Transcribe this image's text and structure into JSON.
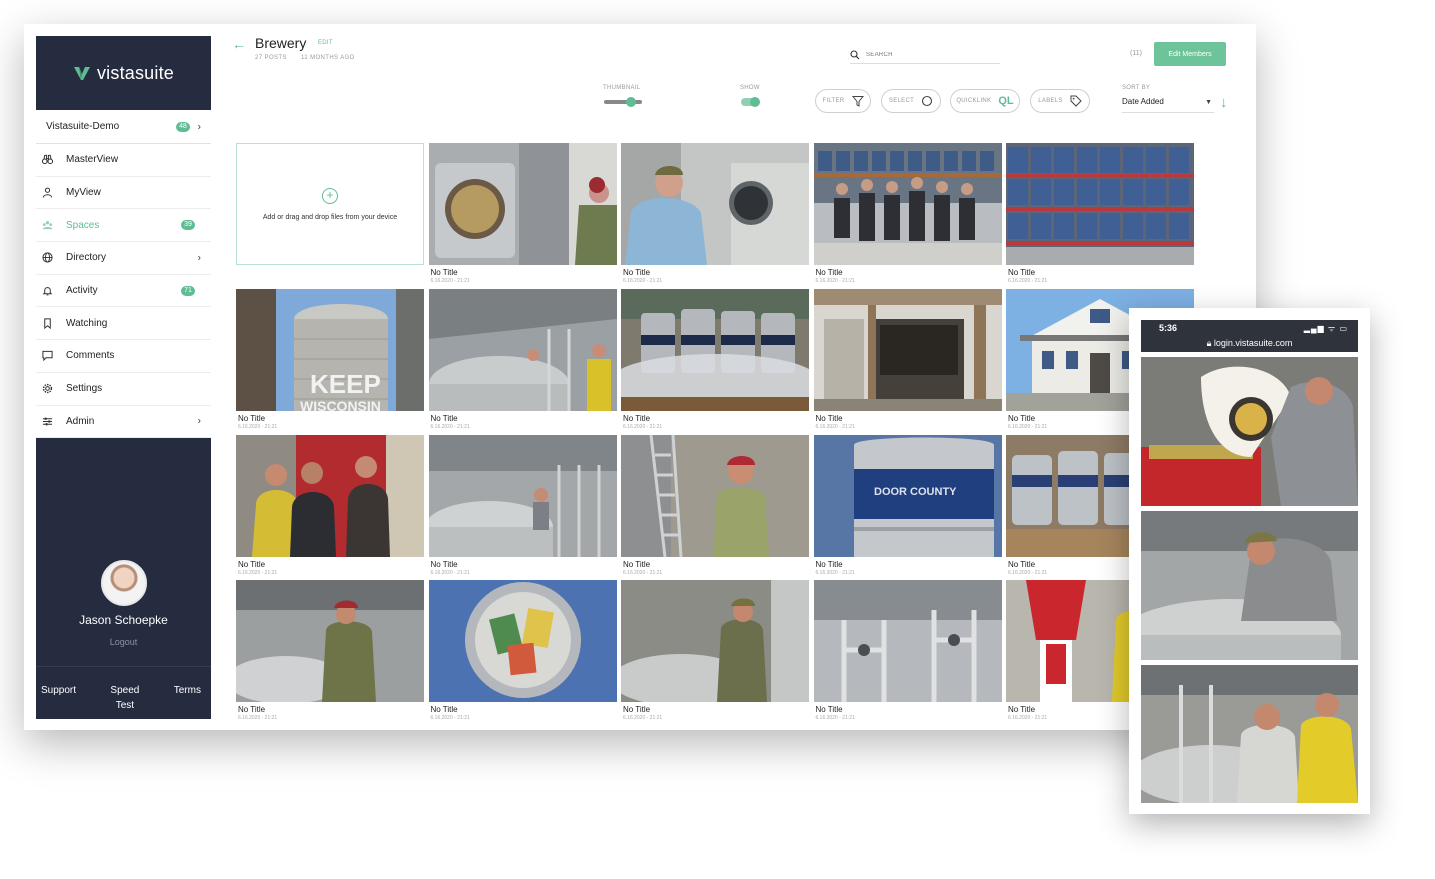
{
  "app": {
    "brand": "vistasuite"
  },
  "sidebar": {
    "space_selector": {
      "label": "Vistasuite-Demo",
      "badge": "48"
    },
    "items": [
      {
        "label": "MasterView",
        "icon": "binoculars-icon"
      },
      {
        "label": "MyView",
        "icon": "person-icon"
      },
      {
        "label": "Spaces",
        "icon": "spaces-icon",
        "badge": "39",
        "active": true
      },
      {
        "label": "Directory",
        "icon": "globe-icon"
      },
      {
        "label": "Activity",
        "icon": "bell-icon",
        "badge": "71"
      },
      {
        "label": "Watching",
        "icon": "bookmark-icon"
      },
      {
        "label": "Comments",
        "icon": "comment-icon"
      },
      {
        "label": "Settings",
        "icon": "gear-icon"
      },
      {
        "label": "Admin",
        "icon": "sliders-icon"
      }
    ],
    "user": {
      "name": "Jason Schoepke",
      "logout": "Logout"
    },
    "footer": {
      "support": "Support",
      "speed_test": "Speed Test",
      "terms": "Terms"
    }
  },
  "header": {
    "title": "Brewery",
    "edit": "EDIT",
    "posts": "27 POSTS",
    "age": "11 MONTHS AGO",
    "search_placeholder": "SEARCH",
    "member_count": "(11)",
    "edit_members": "Edit Members"
  },
  "toolbar": {
    "thumbnail_label": "THUMBNAIL",
    "show_label": "SHOW",
    "filter": "FILTER",
    "select": "SELECT",
    "quicklink": "QUICKLINK",
    "quicklink_icon": "QL",
    "labels": "LABELS",
    "sort_label": "SORT BY",
    "sort_value": "Date Added"
  },
  "upload": {
    "text": "Add or drag and drop files from your device"
  },
  "posts": [
    {
      "title": "No Title",
      "date": "6.16.2020 - 21:21"
    },
    {
      "title": "No Title",
      "date": "6.16.2020 - 21:21"
    },
    {
      "title": "No Title",
      "date": "6.16.2020 - 21:21"
    },
    {
      "title": "No Title",
      "date": "6.16.2020 - 21:21"
    },
    {
      "title": "No Title",
      "date": "6.16.2020 - 21:21"
    },
    {
      "title": "No Title",
      "date": "6.16.2020 - 21:21"
    },
    {
      "title": "No Title",
      "date": "6.16.2020 - 21:21"
    },
    {
      "title": "No Title",
      "date": "6.16.2020 - 21:21"
    },
    {
      "title": "No Title",
      "date": "6.16.2020 - 21:21"
    },
    {
      "title": "No Title",
      "date": "6.16.2020 - 21:21"
    },
    {
      "title": "No Title",
      "date": "6.16.2020 - 21:21"
    },
    {
      "title": "No Title",
      "date": "6.16.2020 - 21:21"
    },
    {
      "title": "No Title",
      "date": "6.16.2020 - 21:21"
    },
    {
      "title": "No Title",
      "date": "6.16.2020 - 21:21"
    },
    {
      "title": "No Title",
      "date": "6.16.2020 - 21:21"
    },
    {
      "title": "No Title",
      "date": "6.16.2020 - 21:21"
    },
    {
      "title": "No Title",
      "date": "6.16.2020 - 21:21"
    },
    {
      "title": "No Title",
      "date": "6.16.2020 - 21:21"
    },
    {
      "title": "No Title",
      "date": "6.16.2020 - 21:21"
    }
  ],
  "photo_signs": {
    "keep": "KEEP",
    "wisconsin": "WISCONSIN",
    "door_county": "DOOR COUNTY"
  },
  "phone": {
    "time": "5:36",
    "status": "▂▄▆ ᯤ ▭",
    "url": "login.vistasuite.com"
  },
  "colors": {
    "accent": "#5fbd93",
    "sidebar": "#252c40",
    "button": "#6dc39a"
  }
}
